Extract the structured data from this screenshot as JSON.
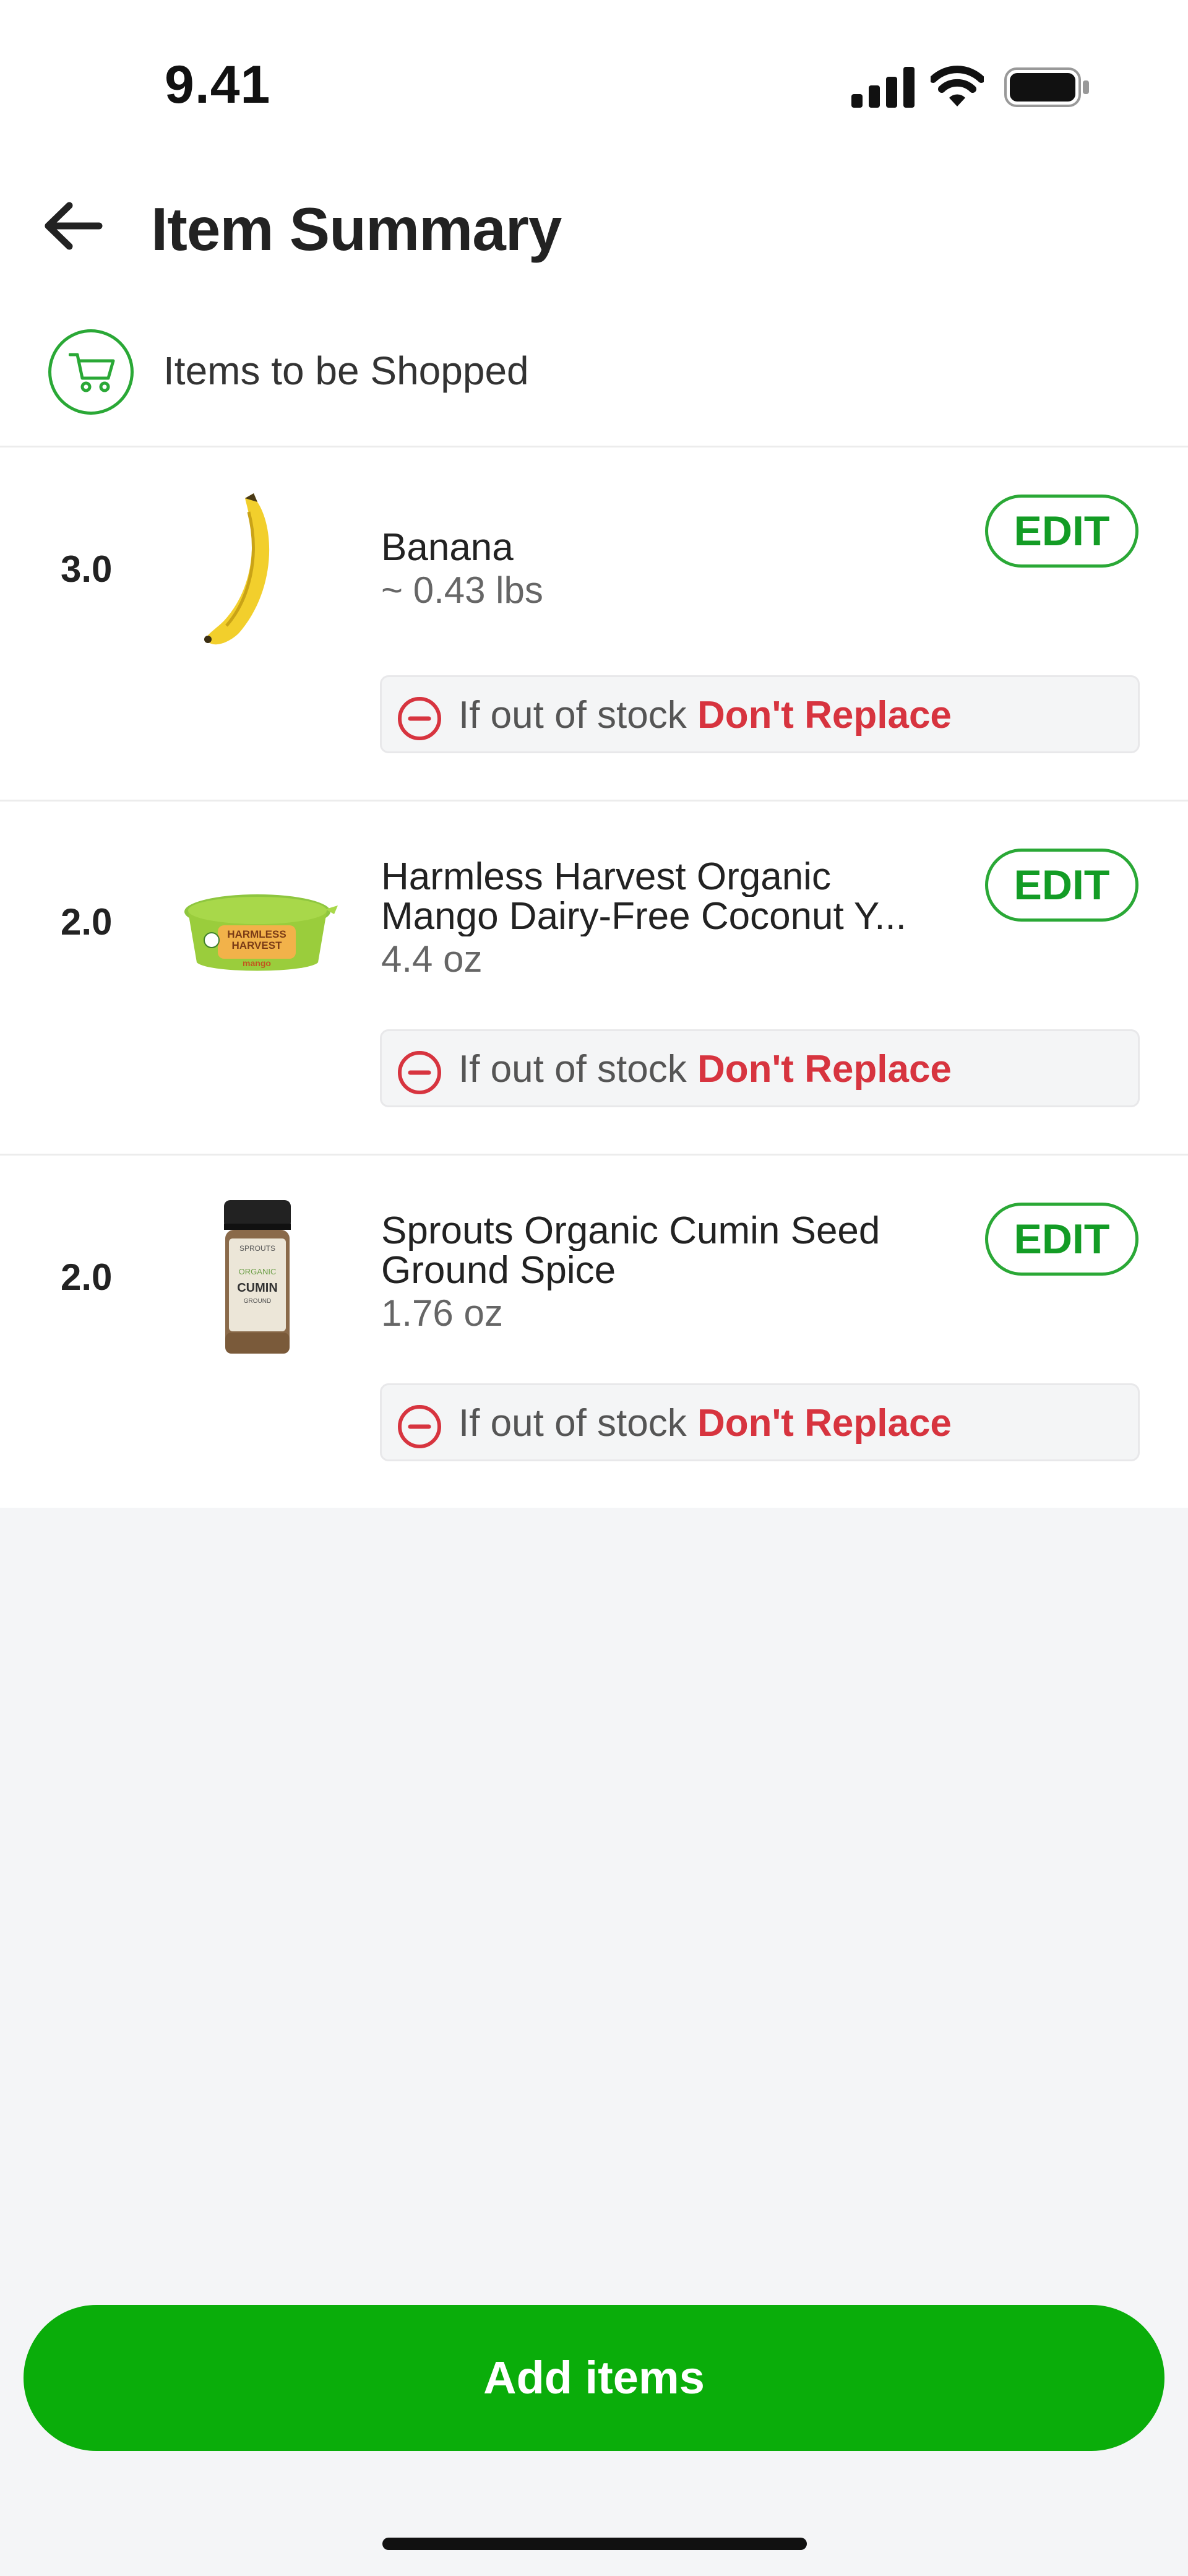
{
  "status_bar": {
    "time": "9.41"
  },
  "header": {
    "title": "Item Summary"
  },
  "section": {
    "label": "Items to be Shopped"
  },
  "items": [
    {
      "qty": "3.0",
      "name_lines": [
        "Banana"
      ],
      "size": "~ 0.43 lbs",
      "edit_label": "EDIT",
      "oos_prefix": "If out of stock",
      "oos_action": "Don't Replace"
    },
    {
      "qty": "2.0",
      "name_lines": [
        "Harmless Harvest Organic",
        "Mango Dairy-Free Coconut Y..."
      ],
      "size": "4.4 oz",
      "edit_label": "EDIT",
      "oos_prefix": "If out of stock",
      "oos_action": "Don't Replace",
      "product_text": {
        "brand_line1": "HARMLESS",
        "brand_line2": "HARVEST",
        "flavor": "mango"
      }
    },
    {
      "qty": "2.0",
      "name_lines": [
        "Sprouts Organic Cumin Seed",
        "Ground Spice"
      ],
      "size": "1.76 oz",
      "edit_label": "EDIT",
      "oos_prefix": "If out of stock",
      "oos_action": "Don't Replace",
      "product_text": {
        "brand": "SPROUTS",
        "organic": "ORGANIC",
        "spice": "CUMIN",
        "sub": "GROUND"
      }
    }
  ],
  "footer": {
    "add_label": "Add items"
  },
  "colors": {
    "brand_green": "#0aad0a",
    "edit_green": "#139c25",
    "danger_red": "#d7343f",
    "page_bg": "#f4f5f7"
  },
  "icons": [
    "signal-icon",
    "wifi-icon",
    "battery-icon",
    "back-arrow-icon",
    "cart-icon",
    "minus-circle-icon"
  ]
}
